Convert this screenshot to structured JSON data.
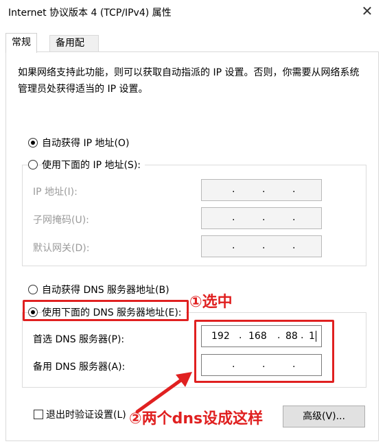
{
  "window": {
    "title": "Internet 协议版本 4 (TCP/IPv4) 属性",
    "close_glyph": "✕"
  },
  "tabs": [
    {
      "label": "常规"
    },
    {
      "label": "备用配置"
    }
  ],
  "description": "如果网络支持此功能，则可以获取自动指派的 IP 设置。否则，你需要从网络系统管理员处获得适当的 IP 设置。",
  "ip_section": {
    "auto_label": "自动获得 IP 地址(O)",
    "manual_label": "使用下面的 IP 地址(S):",
    "ip_label": "IP 地址(I):",
    "mask_label": "子网掩码(U):",
    "gateway_label": "默认网关(D):"
  },
  "dns_section": {
    "auto_label": "自动获得 DNS 服务器地址(B)",
    "manual_label": "使用下面的 DNS 服务器地址(E):",
    "preferred_label": "首选 DNS 服务器(P):",
    "preferred_octets": [
      "192",
      "168",
      "88",
      "1"
    ],
    "alternate_label": "备用 DNS 服务器(A):"
  },
  "footer": {
    "validate_label": "退出时验证设置(L)",
    "advanced_label": "高级(V)..."
  },
  "annotations": {
    "step1": "①选中",
    "step2": "②两个dns设成这样",
    "color": "#e02020"
  },
  "dot": "."
}
